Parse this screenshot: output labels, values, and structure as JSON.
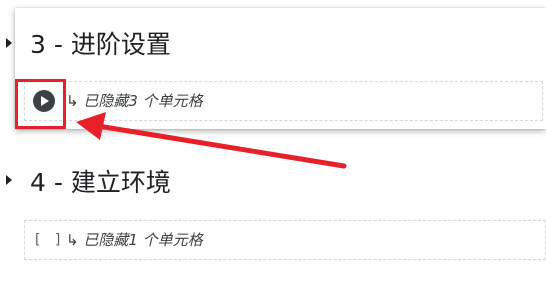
{
  "sections": [
    {
      "heading": "3 - 进阶设置",
      "hidden_cells_text": "已隐藏3 个单元格",
      "run_control": "run-button"
    },
    {
      "heading": "4 - 建立环境",
      "hidden_cells_text": "已隐藏1 个单元格",
      "run_control": "[ ]"
    }
  ],
  "colors": {
    "annotation": "#e8202a",
    "text": "#202124"
  }
}
